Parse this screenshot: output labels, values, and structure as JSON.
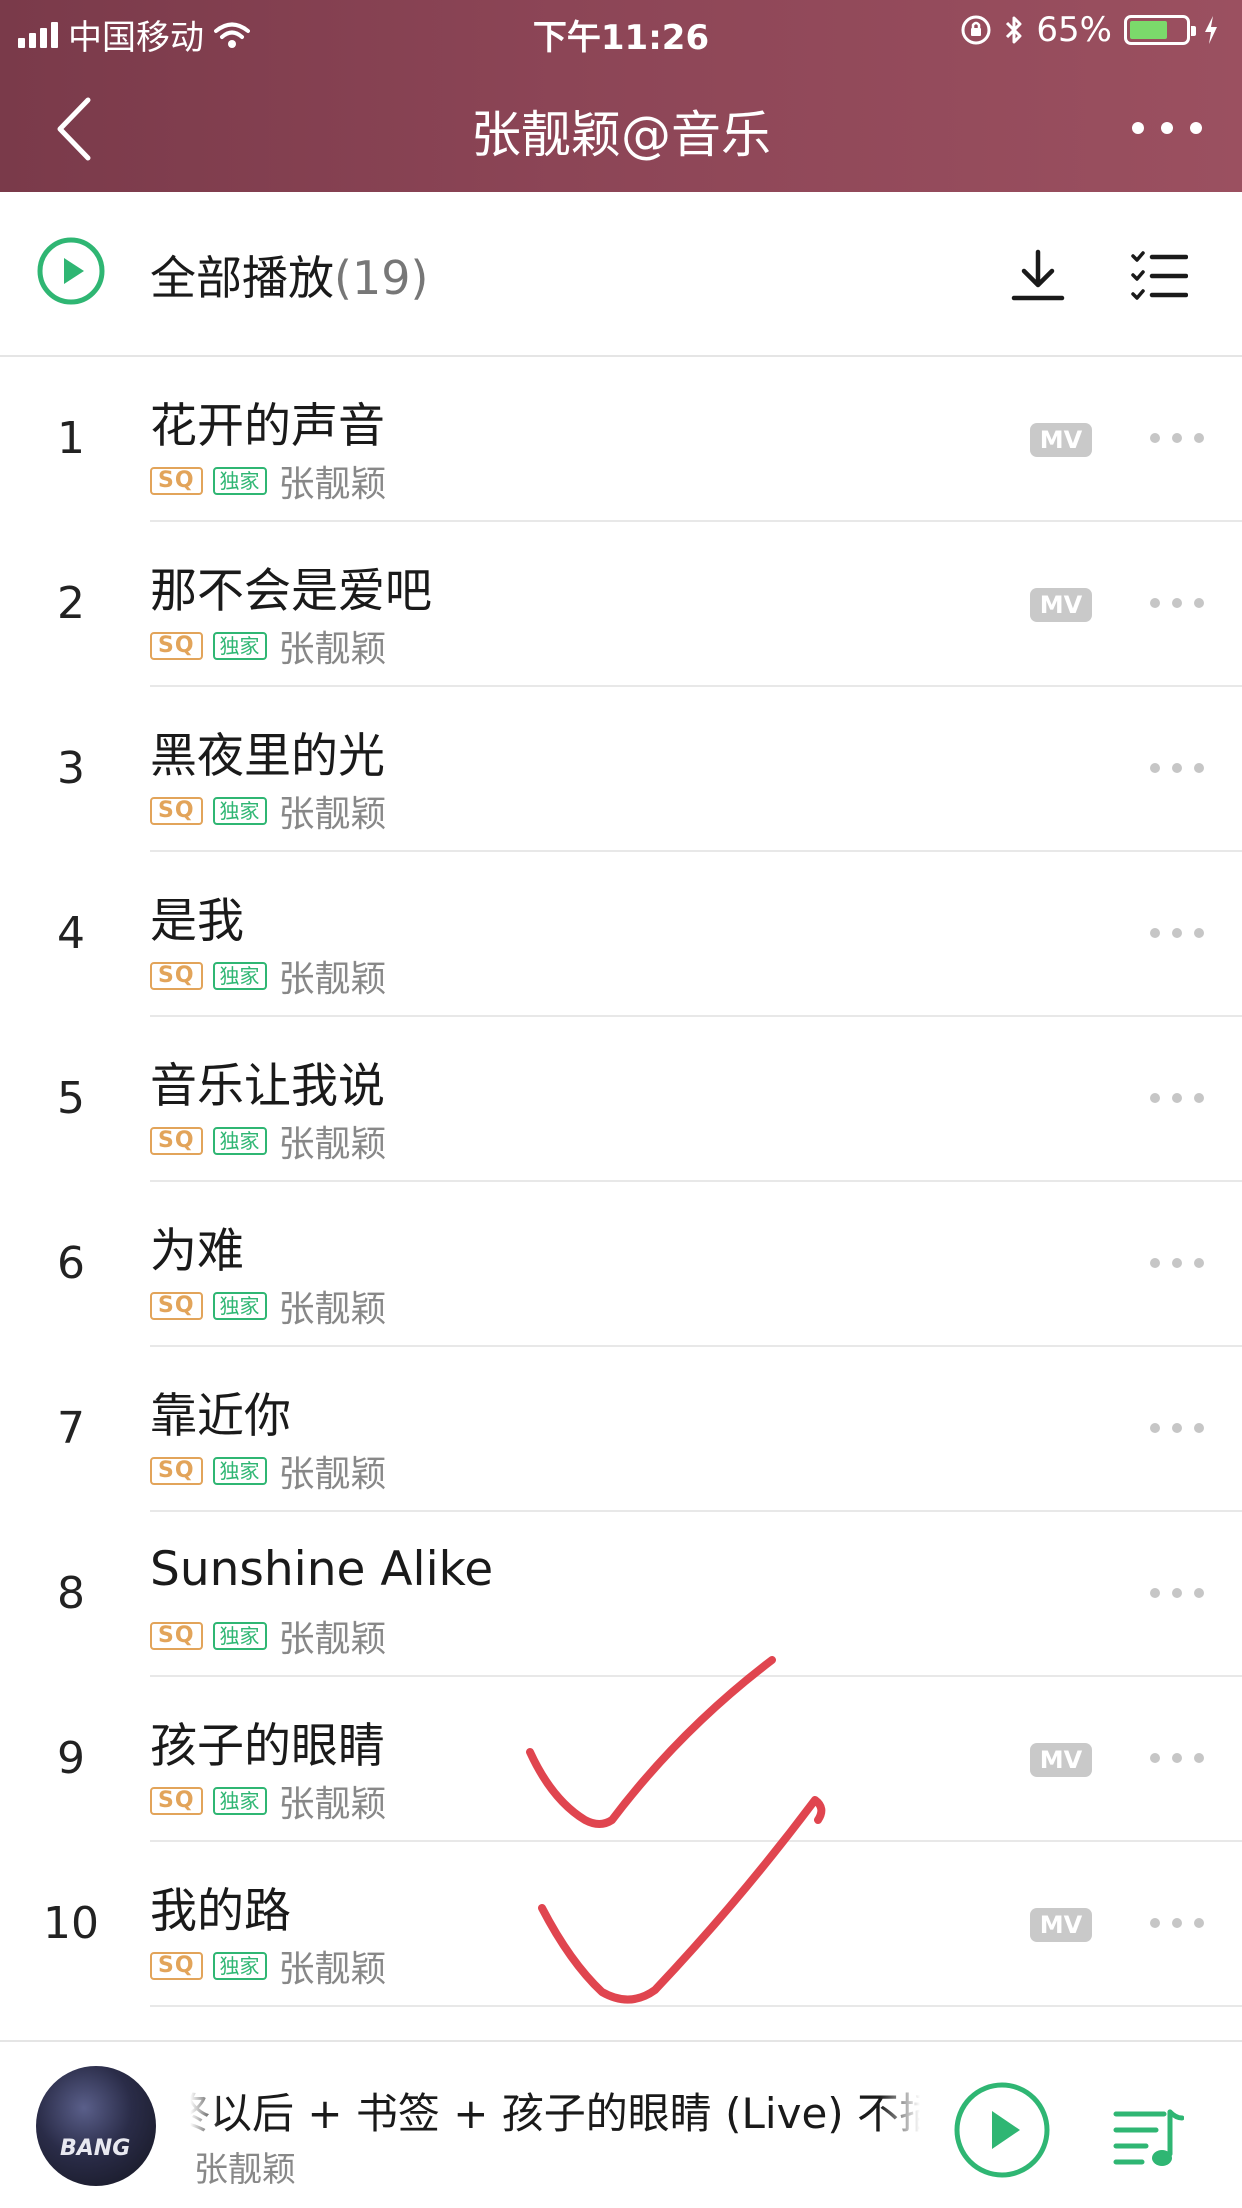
{
  "status_bar": {
    "carrier": "中国移动",
    "time": "下午11:26",
    "battery_percent": "65%",
    "battery_level": 0.62
  },
  "nav": {
    "title": "张靓颖@音乐",
    "back_icon": "chevron-left-icon",
    "more_icon": "more-horizontal-icon"
  },
  "play_all": {
    "label": "全部播放",
    "count": "(19)",
    "icons": [
      "play-circle-icon",
      "download-icon",
      "multi-select-list-icon"
    ]
  },
  "colors": {
    "header": "#8c4556",
    "accent_green": "#2fb673",
    "sq_gold": "#e2a45a",
    "annotation_red": "#e0454f"
  },
  "badges": {
    "sq": "SQ",
    "exclusive": "独家",
    "mv": "MV"
  },
  "songs": [
    {
      "index": "1",
      "title": "花开的声音",
      "artist": "张靓颖",
      "mv": true
    },
    {
      "index": "2",
      "title": "那不会是爱吧",
      "artist": "张靓颖",
      "mv": true
    },
    {
      "index": "3",
      "title": "黑夜里的光",
      "artist": "张靓颖",
      "mv": false
    },
    {
      "index": "4",
      "title": "是我",
      "artist": "张靓颖",
      "mv": false
    },
    {
      "index": "5",
      "title": "音乐让我说",
      "artist": "张靓颖",
      "mv": false
    },
    {
      "index": "6",
      "title": "为难",
      "artist": "张靓颖",
      "mv": false
    },
    {
      "index": "7",
      "title": "靠近你",
      "artist": "张靓颖",
      "mv": false
    },
    {
      "index": "8",
      "title": "Sunshine Alike",
      "artist": "张靓颖",
      "mv": false
    },
    {
      "index": "9",
      "title": "孩子的眼睛",
      "artist": "张靓颖",
      "mv": true
    },
    {
      "index": "10",
      "title": "我的路",
      "artist": "张靓颖",
      "mv": true
    }
  ],
  "player": {
    "track": "终以后 + 书签 + 孩子的眼睛 (Live) 不插电",
    "artist": "张靓颖",
    "cover_text": "BANG",
    "icons": [
      "play-circle-icon",
      "playlist-queue-icon"
    ]
  }
}
